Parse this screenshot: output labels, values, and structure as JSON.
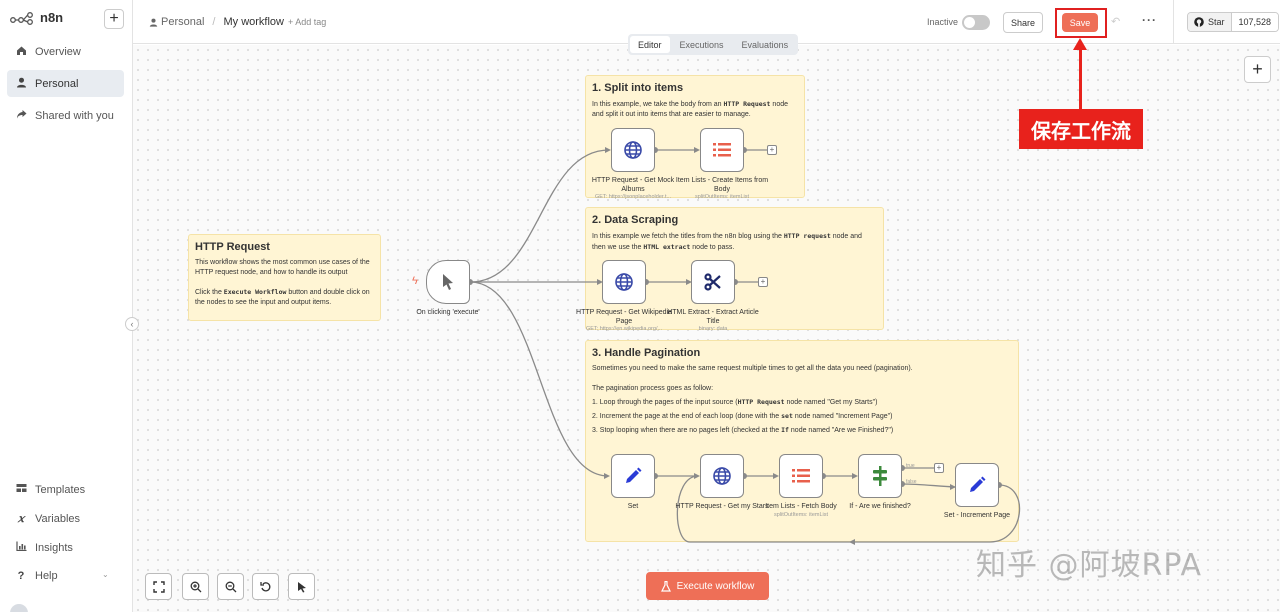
{
  "app": {
    "name": "n8n"
  },
  "sidebar": {
    "items": [
      {
        "label": "Overview",
        "icon": "home-icon"
      },
      {
        "label": "Personal",
        "icon": "user-icon",
        "active": true
      },
      {
        "label": "Shared with you",
        "icon": "share-icon"
      }
    ],
    "bottom_items": [
      {
        "label": "Templates",
        "icon": "templates-icon"
      },
      {
        "label": "Variables",
        "icon": "variables-icon"
      },
      {
        "label": "Insights",
        "icon": "insights-icon"
      },
      {
        "label": "Help",
        "icon": "help-icon"
      }
    ]
  },
  "header": {
    "breadcrumb_project": "Personal",
    "breadcrumb_separator": "/",
    "workflow_name": "My workflow",
    "add_tag": "+ Add tag",
    "status": "Inactive",
    "share_label": "Share",
    "save_label": "Save",
    "github_star": "Star",
    "github_count": "107,528"
  },
  "tabs": [
    {
      "label": "Editor",
      "active": true
    },
    {
      "label": "Executions"
    },
    {
      "label": "Evaluations"
    }
  ],
  "stickies": {
    "intro": {
      "title": "HTTP Request",
      "line1": "This workflow shows the most common use cases of the HTTP request node, and how to handle its output",
      "line2a": "Click the ",
      "line2b": "Execute Workflow",
      "line2c": " button and double click on the nodes to see the input and output items."
    },
    "split": {
      "title": "1. Split into items",
      "a": "In this example, we take the body from an ",
      "b": "HTTP Request",
      "c": " node and split it out into items that are easier to manage."
    },
    "scrape": {
      "title": "2. Data Scraping",
      "a": "In this example we fetch the titles from the n8n blog using the ",
      "b": "HTTP request",
      "c": " node and then we use the ",
      "d": "HTML extract",
      "e": " node to pass."
    },
    "pagination": {
      "title": "3. Handle Pagination",
      "intro": "Sometimes you need to make the same request multiple times to get all the data you need (pagination).",
      "process": "The pagination process goes as follow:",
      "s1a": "1. Loop through the pages of the input source (",
      "s1b": "HTTP Request",
      "s1c": " node named \"Get my Starts\")",
      "s2a": "2. Increment the page at the end of each loop (done with the ",
      "s2b": "set",
      "s2c": " node named \"Increment Page\")",
      "s3a": "3. Stop looping when there are no pages left (checked at the ",
      "s3b": "If",
      "s3c": " node named \"Are we Finished?\")"
    }
  },
  "nodes": {
    "trigger": {
      "label": "On clicking 'execute'",
      "icon": "cursor-icon"
    },
    "mock_albums": {
      "label": "HTTP Request - Get Mock Albums",
      "sub": "GET: https://jsonplaceholder.t...",
      "icon": "globe-icon"
    },
    "create_items": {
      "label": "Item Lists - Create Items from Body",
      "sub": "splitOutItems: itemList",
      "icon": "list-icon"
    },
    "wiki": {
      "label": "HTTP Request - Get Wikipedia Page",
      "sub": "GET: https://en.wikipedia.org/...",
      "icon": "globe-icon"
    },
    "html_extract": {
      "label": "HTML Extract - Extract Article Title",
      "sub": "binary: data",
      "icon": "scissors-icon"
    },
    "set": {
      "label": "Set",
      "icon": "pen-icon"
    },
    "stars": {
      "label": "HTTP Request - Get my Stars",
      "icon": "globe-icon"
    },
    "fetch_body": {
      "label": "Item Lists - Fetch Body",
      "sub": "splitOutItems: itemList",
      "icon": "list-icon"
    },
    "if_finished": {
      "label": "If - Are we finished?",
      "icon": "if-icon"
    },
    "increment": {
      "label": "Set - Increment Page",
      "icon": "pen-icon"
    },
    "edge_true": "true",
    "edge_false": "false"
  },
  "execute_label": "Execute workflow",
  "annotation": "保存工作流",
  "watermark": "知乎 @阿坡RPA",
  "colors": {
    "accent": "#ee6f57",
    "sticky": "#fff5d4",
    "annotation": "#e8221c"
  }
}
